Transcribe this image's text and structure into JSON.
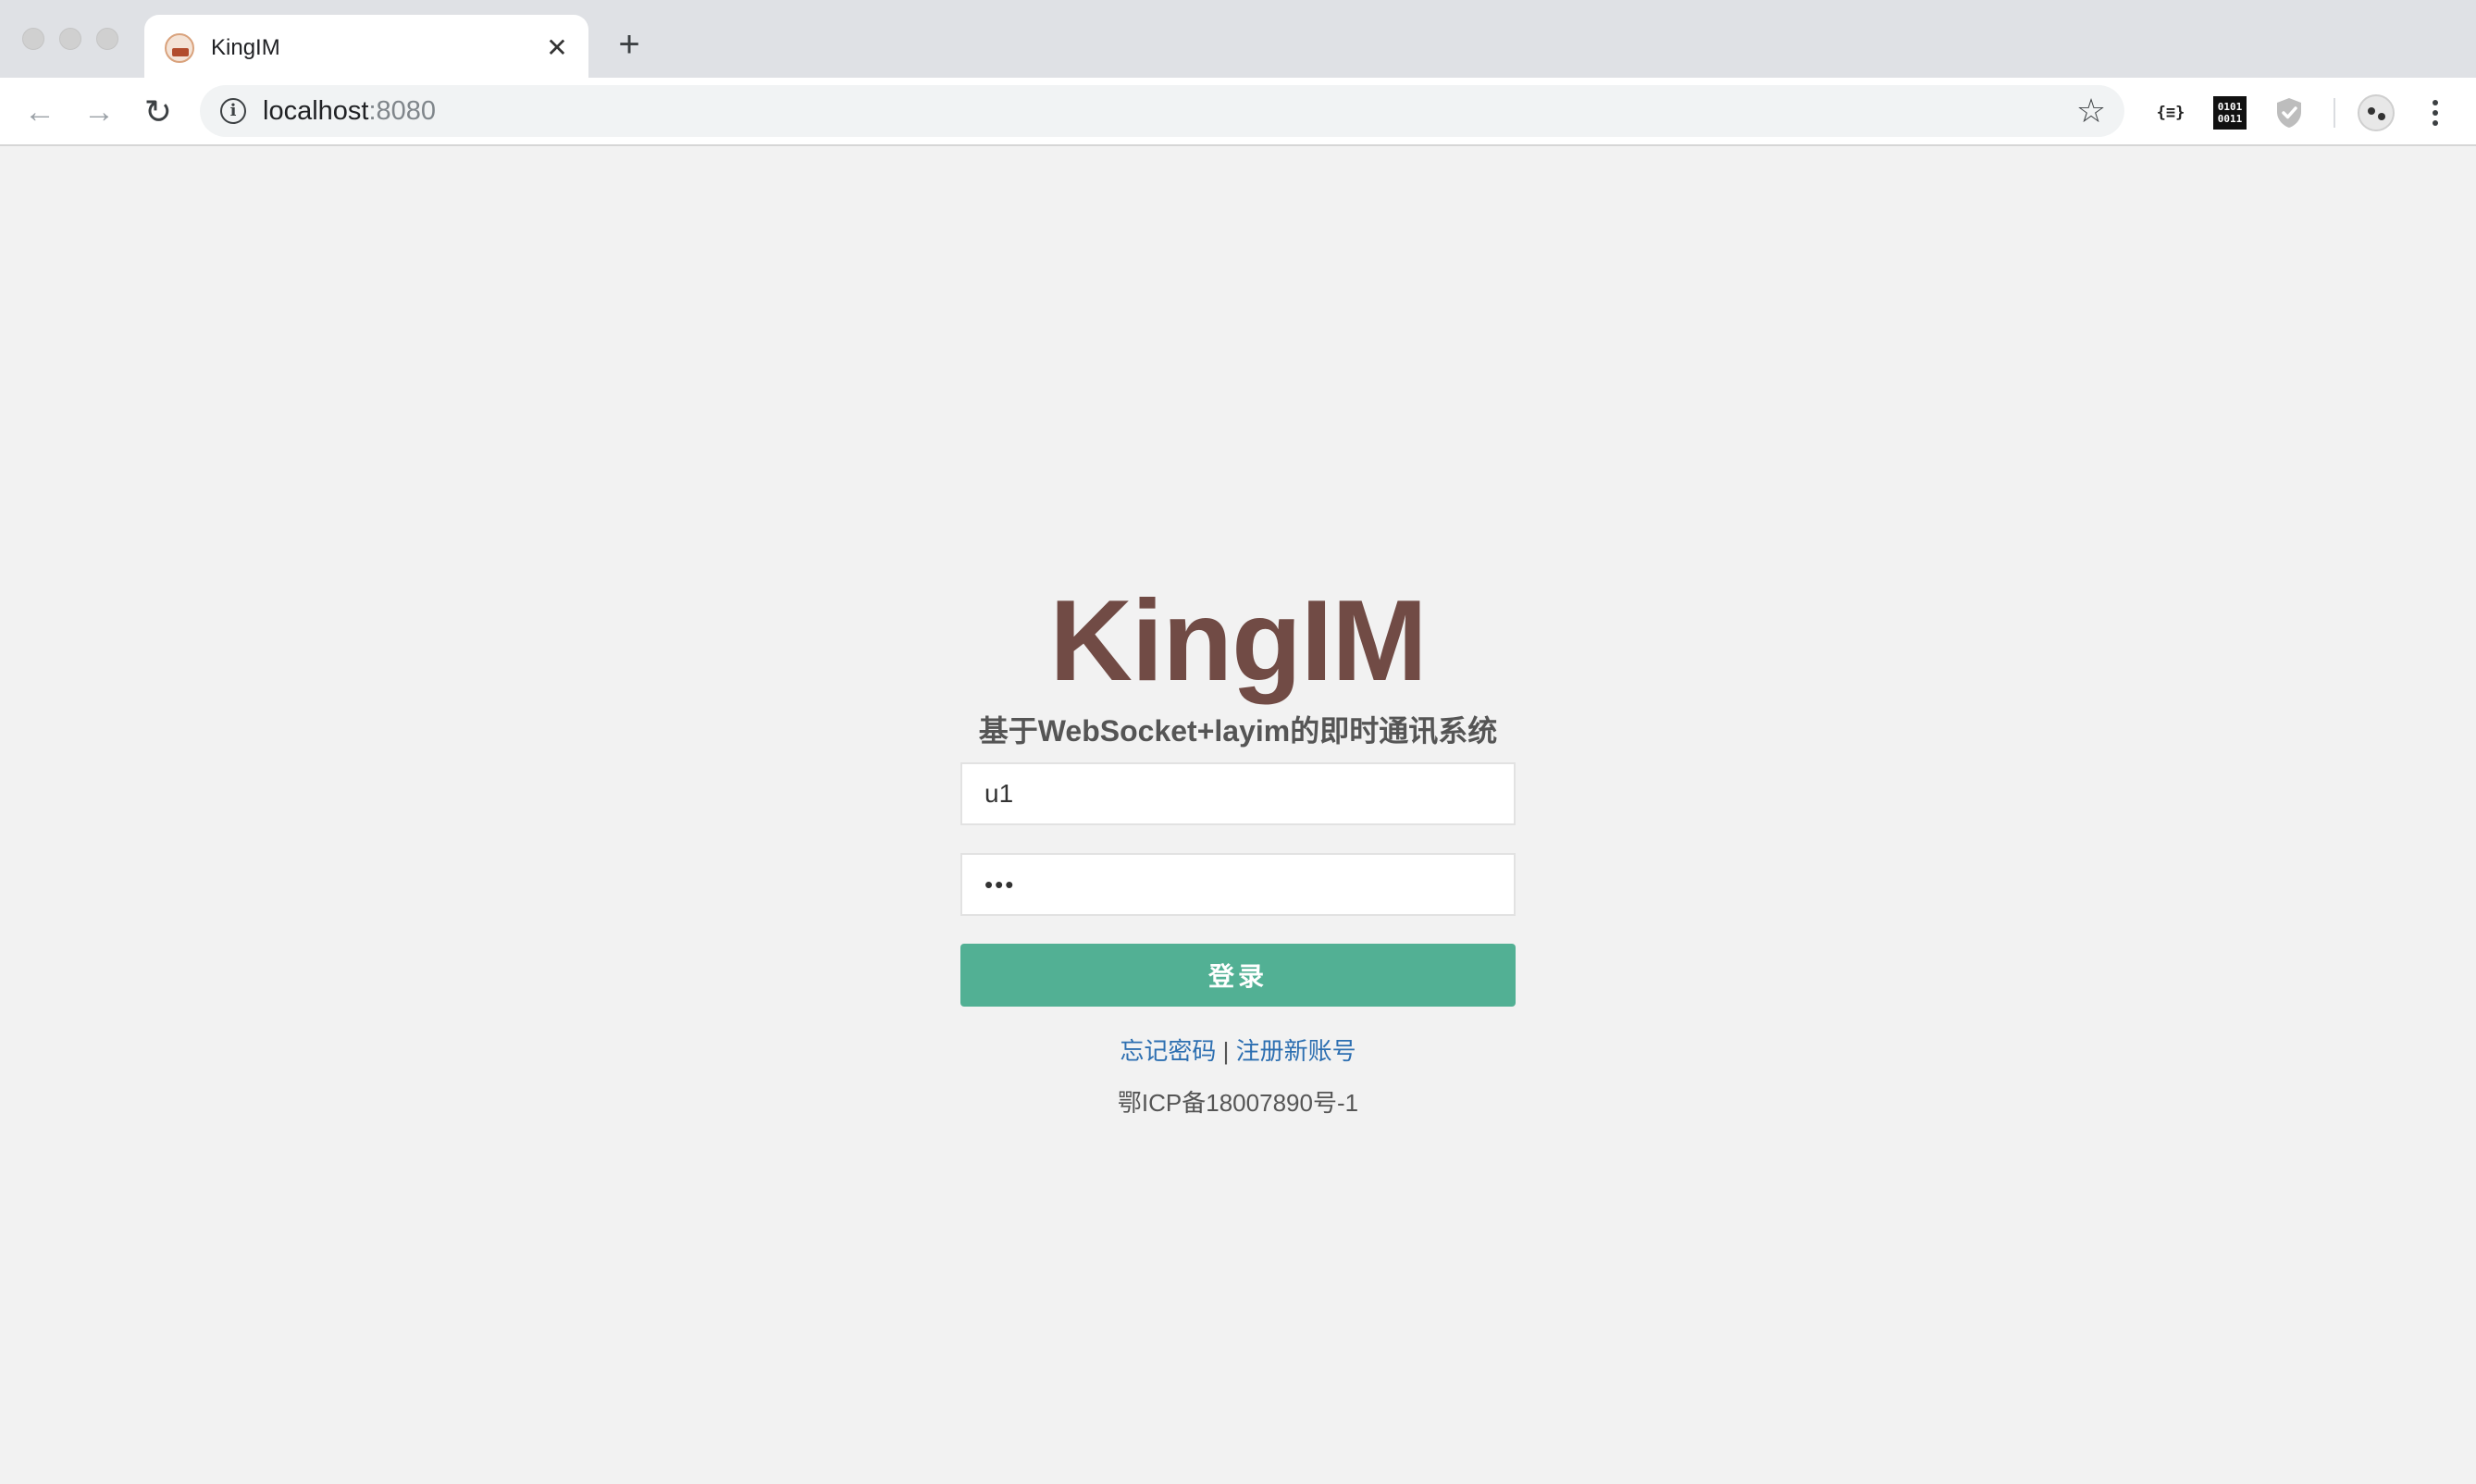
{
  "browser": {
    "tab": {
      "title": "KingIM",
      "close_glyph": "✕",
      "favicon": "data-logo-icon"
    },
    "new_tab_glyph": "+",
    "nav": {
      "back_glyph": "←",
      "forward_glyph": "→",
      "reload_glyph": "↻"
    },
    "address": {
      "host": "localhost",
      "port": ":8080"
    },
    "bookmark_glyph": "☆",
    "extensions": {
      "json_label": "{≡}",
      "binary_top": "0101",
      "binary_bottom": "0011"
    }
  },
  "page": {
    "brand": "KingIM",
    "subtitle": "基于WebSocket+layim的即时通讯系统",
    "username": {
      "value": "u1",
      "placeholder": ""
    },
    "password": {
      "value": "123",
      "placeholder": ""
    },
    "login_button": "登录",
    "forgot_link": "忘记密码",
    "separator": "|",
    "register_link": "注册新账号",
    "icp": "鄂ICP备18007890号-1"
  },
  "colors": {
    "brand": "#714b45",
    "button": "#52b094",
    "link": "#2d6fb1",
    "background": "#f2f2f2"
  }
}
